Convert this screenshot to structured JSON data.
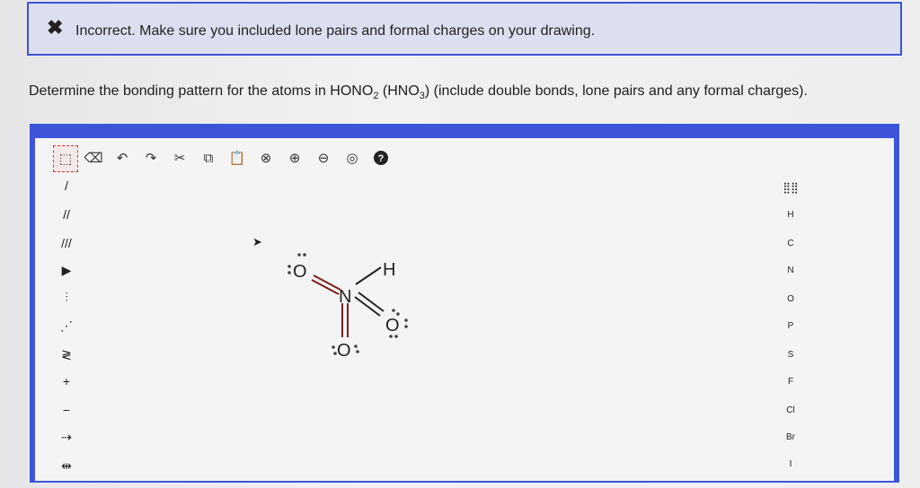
{
  "feedback": {
    "icon": "close-icon",
    "message": "Incorrect. Make sure you included lone pairs and formal charges on your drawing."
  },
  "question": {
    "prefix": "Determine the bonding pattern for the atoms in HONO",
    "sub1": "2",
    "middle": " (HNO",
    "sub2": "3",
    "suffix": ") (include double bonds, lone pairs and any formal charges)."
  },
  "toolbar": {
    "items": [
      "select-icon",
      "erase-icon",
      "undo-icon",
      "redo-icon",
      "cut-icon",
      "copy-icon",
      "paste-icon",
      "zoom-reset-icon",
      "zoom-in-icon",
      "zoom-out-icon",
      "zoom-fit-icon",
      "help-icon"
    ],
    "help_label": "?"
  },
  "left_tools": {
    "items": [
      {
        "name": "single-bond-tool",
        "glyph": "/"
      },
      {
        "name": "double-bond-tool",
        "glyph": "//"
      },
      {
        "name": "triple-bond-tool",
        "glyph": "///"
      },
      {
        "name": "wedge-bond-tool",
        "glyph": "▶"
      },
      {
        "name": "hash-bond-tool",
        "glyph": "⫶"
      },
      {
        "name": "dash-bond-tool",
        "glyph": "⋰"
      },
      {
        "name": "resonance-tool",
        "glyph": "≷"
      },
      {
        "name": "plus-charge-tool",
        "glyph": "+"
      },
      {
        "name": "minus-charge-tool",
        "glyph": "−"
      },
      {
        "name": "plus-arrow-tool",
        "glyph": "⇢"
      },
      {
        "name": "double-arrow-tool",
        "glyph": "⇹"
      }
    ]
  },
  "elements": [
    "H",
    "C",
    "N",
    "O",
    "P",
    "S",
    "F",
    "Cl",
    "Br",
    "I"
  ],
  "molecule": {
    "atoms": {
      "o_left": "O",
      "n_center": "N",
      "h_top": "H",
      "o_right": "O",
      "o_bottom": "O"
    }
  },
  "colors": {
    "feedback_border": "#3d54d8",
    "feedback_bg": "#dcdff0",
    "bond_double": "#7a1f1f",
    "bond_single": "#222222"
  }
}
